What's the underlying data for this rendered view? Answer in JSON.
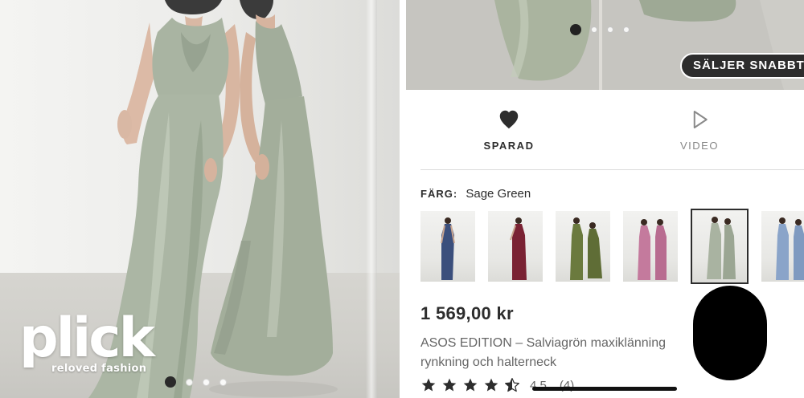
{
  "hero": {
    "image_alt": "Two models wearing sage green halter-neck satin maxi dresses",
    "carousel_dots": 4,
    "active_dot": 1
  },
  "branding": {
    "logo_text": "plick",
    "tagline": "reloved fashion"
  },
  "product_gallery": {
    "carousel_dots": 4,
    "active_dot": 1,
    "badge": "SÄLJER SNABBT"
  },
  "actions": {
    "saved_label": "SPARAD",
    "video_label": "VIDEO"
  },
  "color": {
    "label": "FÄRG:",
    "selected": "Sage Green",
    "swatches": [
      {
        "name": "navy",
        "dress": "#3b4f7c"
      },
      {
        "name": "burgundy",
        "dress": "#7a2233"
      },
      {
        "name": "olive",
        "dress": "#6b7a3e"
      },
      {
        "name": "mauve",
        "dress": "#c47a9d"
      },
      {
        "name": "sage-green",
        "dress": "#a9b3a1",
        "selected": true
      },
      {
        "name": "dusty-blue",
        "dress": "#8aa4c9"
      }
    ]
  },
  "product": {
    "price": "1 569,00 kr",
    "name": "ASOS EDITION – Salviagrön maxiklänning rynkning och halterneck"
  },
  "rating": {
    "value": 4.5,
    "stars": 5,
    "score": "4,5",
    "count": "(4)"
  },
  "colors": {
    "dress_sage": "#a7b3a0",
    "text_dark": "#2d2d2d",
    "text_muted": "#666666",
    "badge_bg": "#2d2d2d"
  }
}
